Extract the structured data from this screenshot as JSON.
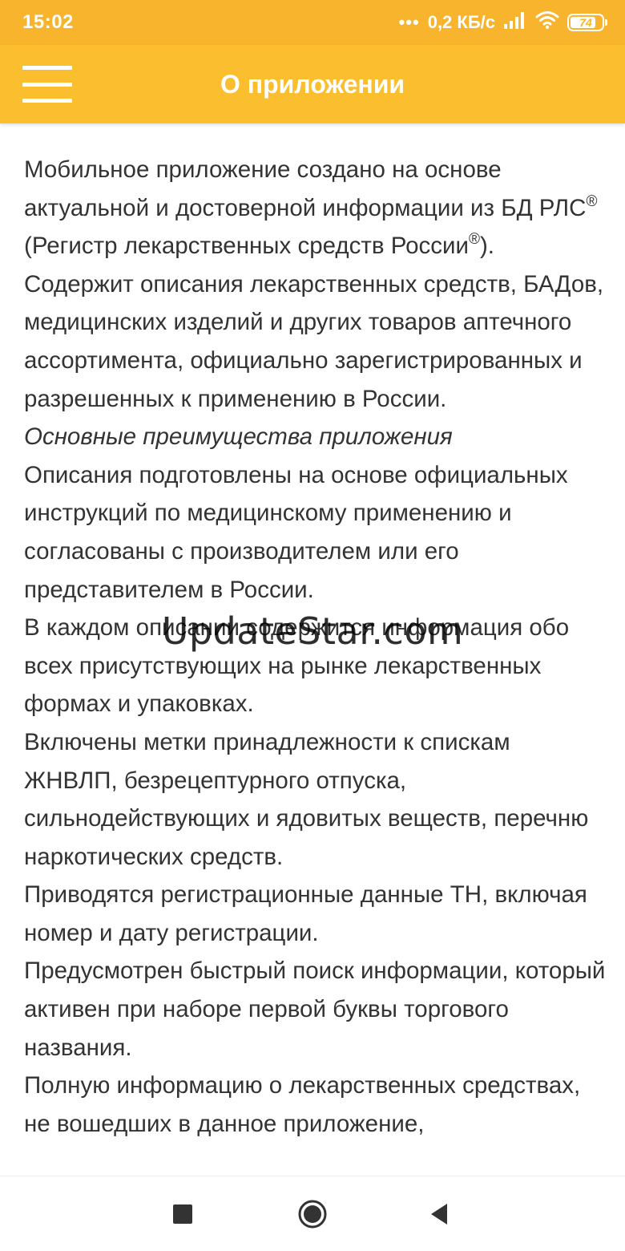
{
  "status_bar": {
    "time": "15:02",
    "dots": "•••",
    "network_speed": "0,2 КБ/с",
    "battery_level": "74",
    "icons": [
      "signal-icon",
      "wifi-icon",
      "battery-icon"
    ]
  },
  "app_bar": {
    "title": "О приложении",
    "menu_icon": "hamburger-menu-icon"
  },
  "content": {
    "intro_part1": "Мобильное приложение создано на основе актуальной и достоверной информации из БД РЛС",
    "registered_mark": "®",
    "intro_part2": " (Регистр лекарственных средств России",
    "intro_part3": "). Содержит описания лекарственных средств, БАДов, медицинских изделий и других товаров аптечного ассортимента, официально зарегистрированных и разрешенных к применению в России.",
    "advantages_heading": "Основные преимущества приложения",
    "paragraphs": [
      "Описания подготовлены на основе официальных инструкций по медицинскому применению и согласованы с производителем или его представителем в России.",
      "В каждом описании содержится информация обо всех присутствующих на рынке лекарственных формах и упаковках.",
      "Включены метки принадлежности к спискам ЖНВЛП, безрецептурного отпуска, сильнодействующих и ядовитых веществ, перечню наркотических средств.",
      "Приводятся регистрационные данные ТН, включая номер и дату регистрации.",
      "Предусмотрен быстрый поиск информации, который активен при наборе первой буквы торгового названия.",
      "Полную информацию о лекарственных средствах, не вошедших в данное приложение,"
    ]
  },
  "watermark": "UpdateStar.com",
  "nav_bar": {
    "icons": [
      "recent-apps-icon",
      "home-icon",
      "back-icon"
    ]
  },
  "colors": {
    "status_bar": "#f7b42c",
    "app_bar": "#fbbe2e",
    "text": "#333333",
    "background": "#ffffff"
  }
}
